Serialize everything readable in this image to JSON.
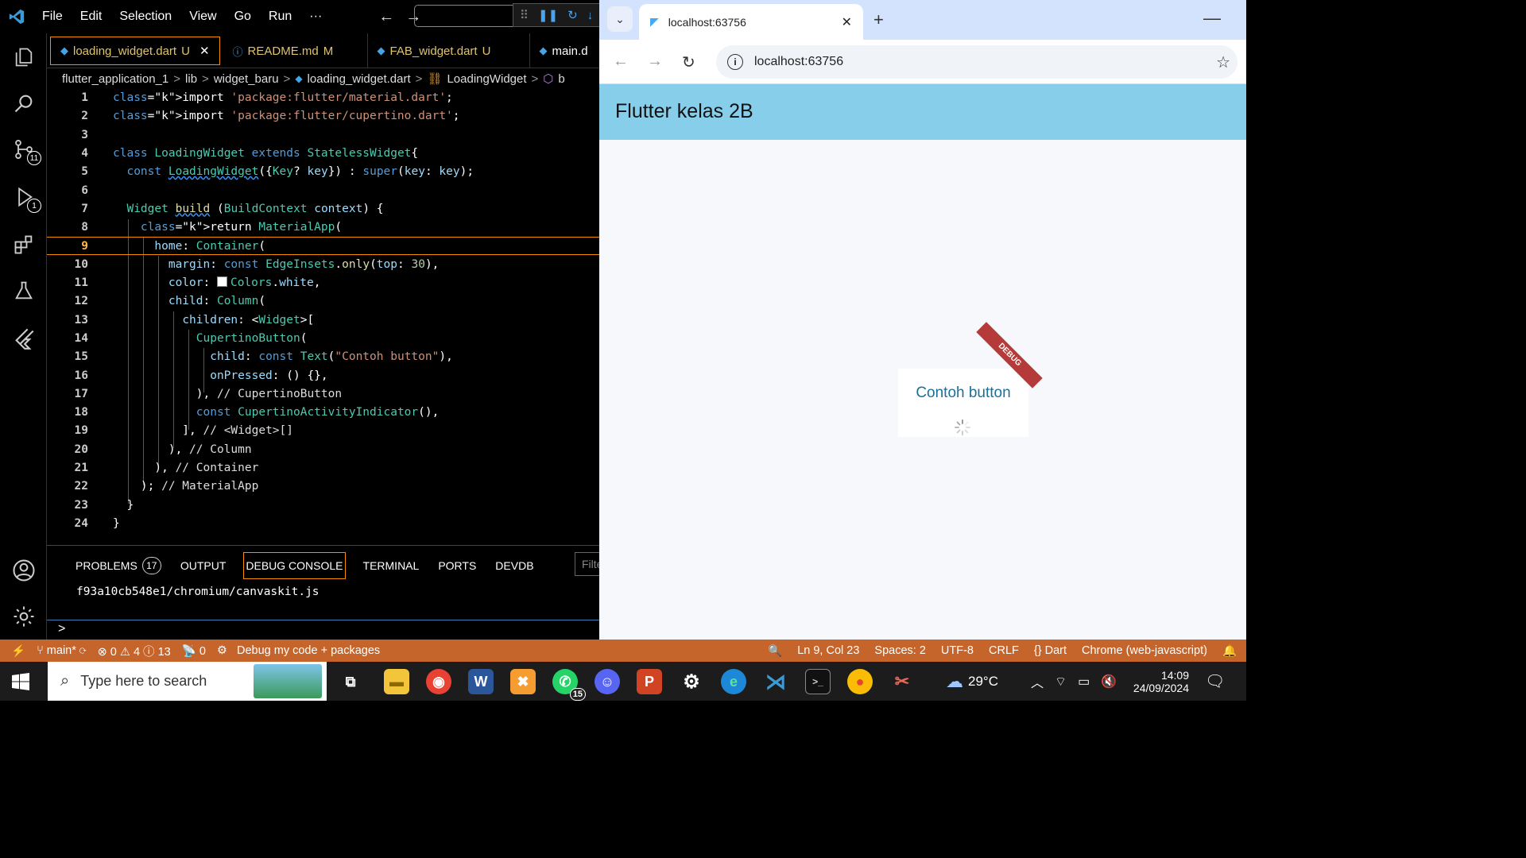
{
  "vscode": {
    "menu": [
      "File",
      "Edit",
      "Selection",
      "View",
      "Go",
      "Run",
      "···"
    ],
    "tabs": [
      {
        "label": "loading_widget.dart",
        "status": "U",
        "active": true
      },
      {
        "label": "README.md",
        "status": "M",
        "active": false
      },
      {
        "label": "FAB_widget.dart",
        "status": "U",
        "active": false
      },
      {
        "label": "main.d",
        "status": "",
        "active": false
      }
    ],
    "breadcrumb": [
      "flutter_application_1",
      "lib",
      "widget_baru",
      "loading_widget.dart",
      "LoadingWidget",
      "b"
    ],
    "activity_badges": {
      "source_control": "11",
      "run_debug": "1"
    },
    "code_lines": [
      "import 'package:flutter/material.dart';",
      "import 'package:flutter/cupertino.dart';",
      "",
      "class LoadingWidget extends StatelessWidget{",
      "  const LoadingWidget({Key? key}) : super(key: key);",
      "",
      "  Widget build (BuildContext context) {",
      "    return MaterialApp(",
      "      home: Container(",
      "        margin: const EdgeInsets.only(top: 30),",
      "        color: Colors.white,",
      "        child: Column(",
      "          children: <Widget>[",
      "            CupertinoButton(",
      "              child: const Text(\"Contoh button\"),",
      "              onPressed: () {},",
      "            ), // CupertinoButton",
      "            const CupertinoActivityIndicator(),",
      "          ], // <Widget>[]",
      "        ), // Column",
      "      ), // Container",
      "    ); // MaterialApp",
      "  }",
      "}"
    ],
    "current_line": 9,
    "panel": {
      "tabs": [
        "PROBLEMS",
        "OUTPUT",
        "DEBUG CONSOLE",
        "TERMINAL",
        "PORTS",
        "DEVDB"
      ],
      "problems_count": "17",
      "active_tab": "DEBUG CONSOLE",
      "filter_placeholder": "Filte",
      "output_line": "f93a10cb548e1/chromium/canvaskit.js",
      "prompt": ">"
    },
    "statusbar": {
      "branch": "main*",
      "errors": "0",
      "warnings": "4",
      "info": "13",
      "ports": "0",
      "debug_config": "Debug my code + packages",
      "position": "Ln 9, Col 23",
      "spaces": "Spaces: 2",
      "encoding": "UTF-8",
      "eol": "CRLF",
      "language": "Dart",
      "device": "Chrome (web-javascript)"
    }
  },
  "browser": {
    "tab_title": "localhost:63756",
    "url": "localhost:63756",
    "app_title": "Flutter kelas 2B",
    "button_label": "Contoh button",
    "debug_banner": "DEBUG"
  },
  "taskbar": {
    "search_placeholder": "Type here to search",
    "whatsapp_badge": "15",
    "weather": "29°C",
    "time": "14:09",
    "date": "24/09/2024"
  },
  "colors": {
    "statusbar": "#c5642b",
    "appbar": "#87ceeb",
    "accent_border": "#f79000"
  }
}
